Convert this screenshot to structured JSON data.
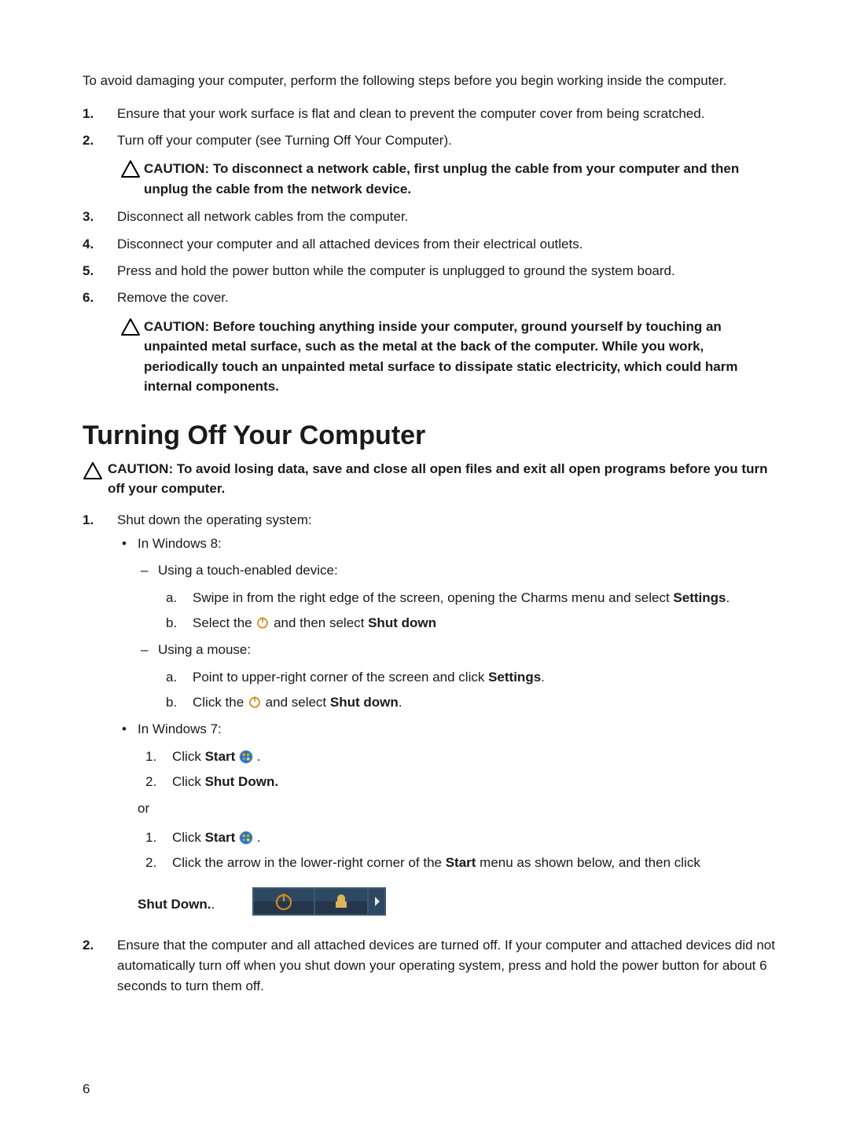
{
  "intro": "To avoid damaging your computer, perform the following steps before you begin working inside the computer.",
  "steps1": {
    "1": "Ensure that your work surface is flat and clean to prevent the computer cover from being scratched.",
    "2": "Turn off your computer (see Turning Off Your Computer).",
    "caution_a": "CAUTION: To disconnect a network cable, first unplug the cable from your computer and then unplug the cable from the network device.",
    "3": "Disconnect all network cables from the computer.",
    "4": "Disconnect your computer and all attached devices from their electrical outlets.",
    "5": "Press and hold the power button while the computer is unplugged to ground the system board.",
    "6": "Remove the cover.",
    "caution_b": "CAUTION: Before touching anything inside your computer, ground yourself by touching an unpainted metal surface, such as the metal at the back of the computer. While you work, periodically touch an unpainted metal surface to dissipate static electricity, which could harm internal components."
  },
  "section_title": "Turning Off Your Computer",
  "caution_top": "CAUTION: To avoid losing data, save and close all open files and exit all open programs before you turn off your computer.",
  "shutdown": {
    "step1": "Shut down the operating system:",
    "win8_label": "In Windows 8:",
    "touch_label": "Using a touch-enabled device:",
    "touch_a_pre": "Swipe in from the right edge of the screen, opening the Charms menu and select ",
    "settings": "Settings",
    "touch_b_pre": "Select the ",
    "touch_b_post": " and then select ",
    "shutdown_label": "Shut down",
    "mouse_label": "Using a mouse:",
    "mouse_a_pre": "Point to upper-right corner of the screen and click ",
    "mouse_b_pre": "Click the ",
    "mouse_b_post": " and select ",
    "win7_label": "In Windows 7:",
    "click_start": "Click ",
    "start_label": "Start",
    "click_shutdown": "Click ",
    "shutdown_bold": "Shut Down.",
    "or": "or",
    "arrow_text_pre": "Click the arrow in the lower-right corner of the ",
    "arrow_text_post": " menu as shown below, and then click",
    "shutdown_row_label": "Shut Down.",
    "step2": "Ensure that the computer and all attached devices are turned off. If your computer and attached devices did not automatically turn off when you shut down your operating system, press and hold the power button for about 6 seconds to turn them off."
  },
  "page_number": "6"
}
